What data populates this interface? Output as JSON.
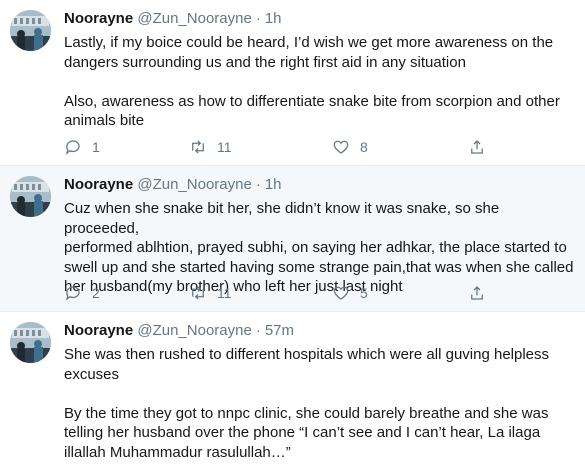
{
  "tweets": [
    {
      "name": "Noorayne",
      "handle": "@Zun_Noorayne",
      "separator": "·",
      "time": "1h",
      "paragraphs": [
        "Lastly, if my boice could be heard, I’d wish we get more awareness on the\ndangers surrounding us and the right first aid in any situation",
        "Also, awareness as how to differentiate snake bite from scorpion and other\nanimals bite"
      ],
      "replies": "1",
      "retweets": "11",
      "likes": "8"
    },
    {
      "name": "Noorayne",
      "handle": "@Zun_Noorayne",
      "separator": "·",
      "time": "1h",
      "paragraphs": [
        "Cuz when she snake bit her, she didn’t know it was snake, so she proceeded,\nperformed ablhtion, prayed subhi, on saying her adhkar, the place started to\nswell up and she started having some strange pain,that was when she called\nher husband(my brother) who left her just last night"
      ],
      "replies": "2",
      "retweets": "11",
      "likes": "5"
    },
    {
      "name": "Noorayne",
      "handle": "@Zun_Noorayne",
      "separator": "·",
      "time": "57m",
      "paragraphs": [
        "She was then rushed to different hospitals which were all guving helpless\nexcuses",
        "By the time they got to nnpc clinic, she could barely breathe and she was\ntelling her husband over the phone “I can’t see and I can’t hear, La ilaga\nillallah Muhammadur rasulullah…”"
      ]
    }
  ],
  "icons": {
    "reply": "speech-bubble-icon",
    "retweet": "retweet-arrows-icon",
    "like": "heart-icon",
    "share": "share-upload-icon"
  },
  "colors": {
    "text": "#14171a",
    "secondary": "#657786",
    "highlight_bg": "#f5f8fa",
    "divider": "#e6ecf0"
  }
}
